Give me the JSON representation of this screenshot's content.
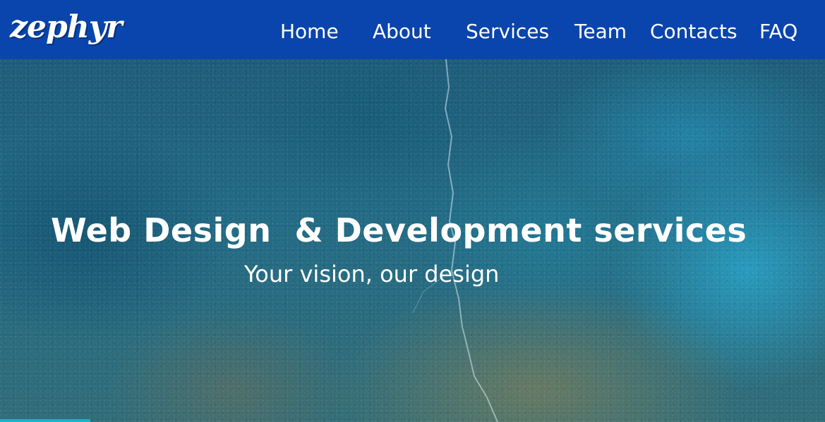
{
  "header": {
    "logo_text": "zephyr",
    "brand_color": "#0a45ad"
  },
  "nav": {
    "items": [
      {
        "label": "Home"
      },
      {
        "label": "About"
      },
      {
        "label": "Services"
      },
      {
        "label": "Team"
      },
      {
        "label": "Contacts"
      },
      {
        "label": "FAQ"
      }
    ]
  },
  "hero": {
    "title": "Web Design  & Development services",
    "subtitle": "Your vision, our design",
    "background_description_color": "#226a84"
  }
}
